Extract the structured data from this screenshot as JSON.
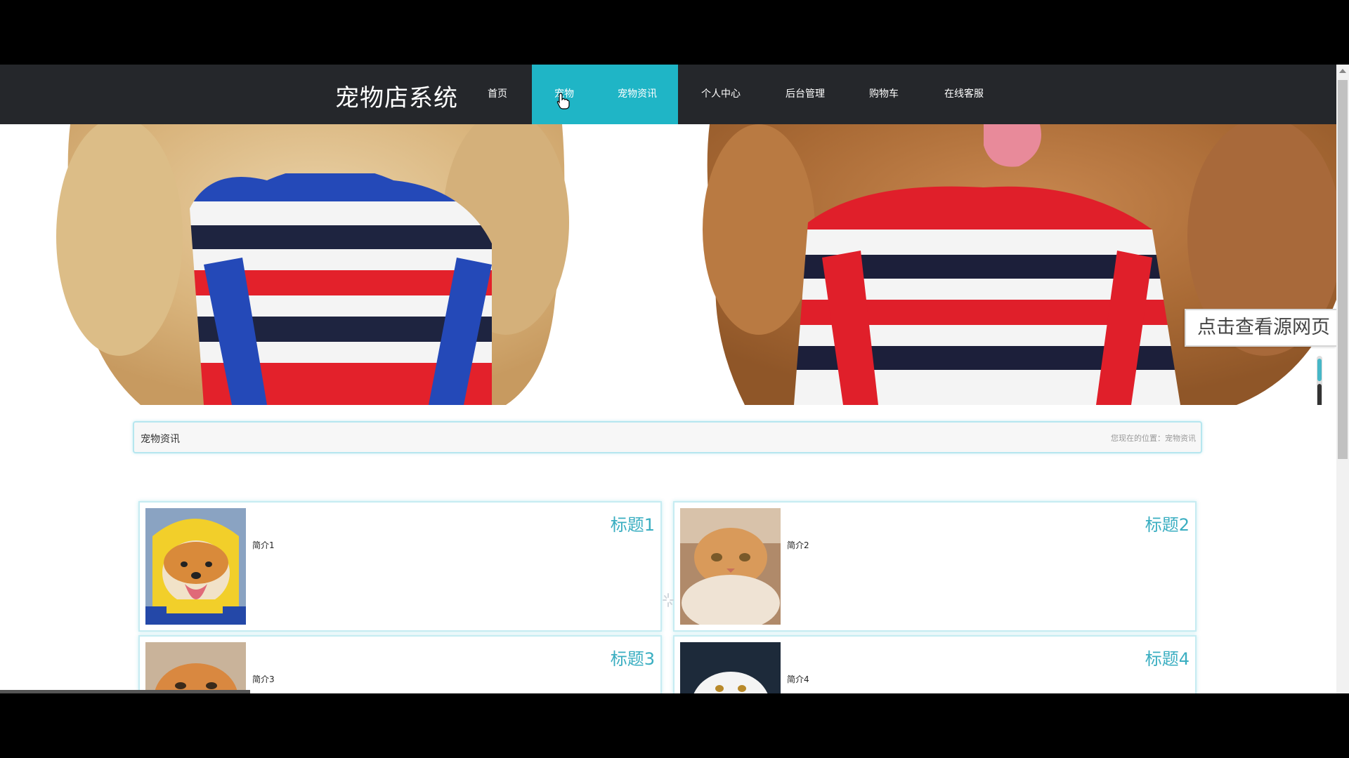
{
  "header": {
    "brand": "宠物店系统",
    "nav": [
      {
        "label": "首页",
        "active": false
      },
      {
        "label": "宠物",
        "active": true
      },
      {
        "label": "宠物资讯",
        "active": true
      },
      {
        "label": "个人中心",
        "active": false
      },
      {
        "label": "后台管理",
        "active": false
      },
      {
        "label": "购物车",
        "active": false
      },
      {
        "label": "在线客服",
        "active": false
      }
    ]
  },
  "banner": {
    "source_tab": "点击查看源网页"
  },
  "breadcrumb": {
    "title": "宠物资讯",
    "location": "您现在的位置：宠物资讯"
  },
  "news": [
    {
      "title": "标题1",
      "intro": "简介1",
      "image": "shiba-dog-yellow-hood"
    },
    {
      "title": "标题2",
      "intro": "简介2",
      "image": "orange-scottish-fold-cat"
    },
    {
      "title": "标题3",
      "intro": "简介3",
      "image": "orange-cat"
    },
    {
      "title": "标题4",
      "intro": "简介4",
      "image": "white-persian-cat"
    }
  ],
  "colors": {
    "accent": "#1fb5c6",
    "nav_bg": "#25272b",
    "title_color": "#3aaec1"
  }
}
